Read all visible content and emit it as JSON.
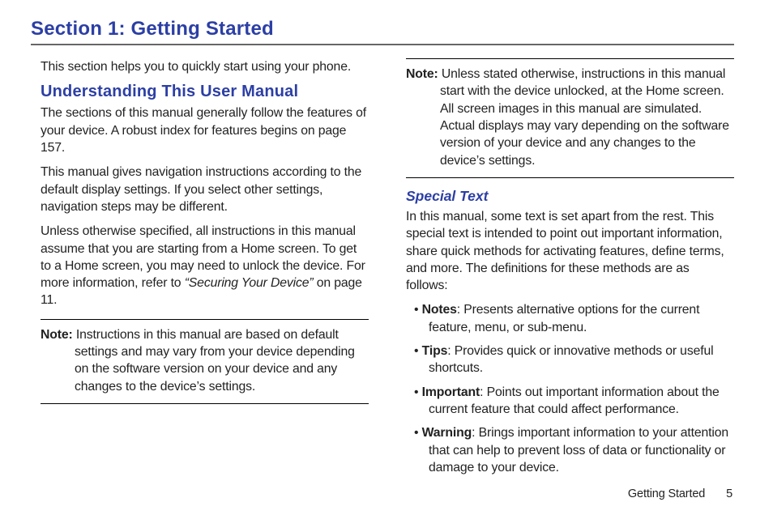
{
  "title": "Section 1: Getting Started",
  "intro": "This section helps you to quickly start using your phone.",
  "heading_understanding": "Understanding This User Manual",
  "para1": "The sections of this manual generally follow the features of your device. A robust index for features begins on page 157.",
  "para2": "This manual gives navigation instructions according to the default display settings. If you select other settings, navigation steps may be different.",
  "para3_prefix": "Unless otherwise specified, all instructions in this manual assume that you are starting from a Home screen. To get to a Home screen, you may need to unlock the device. For more information, refer to ",
  "para3_ref": "“Securing Your Device”",
  "para3_suffix": " on page 11.",
  "note1_label": "Note:",
  "note1_text": " Instructions in this manual are based on default settings and may vary from your device depending on the software version on your device and any changes to the device’s settings.",
  "note2_label": "Note:",
  "note2_text": " Unless stated otherwise, instructions in this manual start with the device unlocked, at the Home screen. All screen images in this manual are simulated. Actual displays may vary depending on the software version of your device and any changes to the device’s settings.",
  "heading_special": "Special Text",
  "special_intro": "In this manual, some text is set apart from the rest. This special text is intended to point out important information, share quick methods for activating features, define terms, and more. The definitions for these methods are as follows:",
  "bullets": {
    "notes": {
      "term": "Notes",
      "def": ": Presents alternative options for the current feature, menu, or sub-menu."
    },
    "tips": {
      "term": "Tips",
      "def": ": Provides quick or innovative methods or useful shortcuts."
    },
    "important": {
      "term": "Important",
      "def": ": Points out important information about the current feature that could affect performance."
    },
    "warning": {
      "term": "Warning",
      "def": ": Brings important information to your attention that can help to prevent loss of data or functionality or damage to your device."
    }
  },
  "footer_section": "Getting Started",
  "footer_page": "5"
}
